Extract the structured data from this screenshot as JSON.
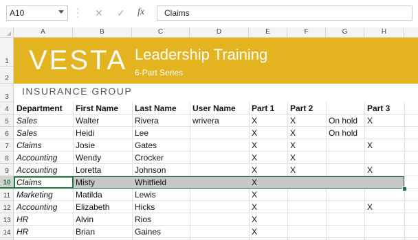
{
  "formula_bar": {
    "name_box": "A10",
    "cancel_icon": "close-icon",
    "enter_icon": "check-icon",
    "fx_label": "fx",
    "formula": "Claims"
  },
  "columns": [
    "A",
    "B",
    "C",
    "D",
    "E",
    "F",
    "G",
    "H"
  ],
  "rows": [
    "1",
    "2",
    "3",
    "4",
    "5",
    "6",
    "7",
    "8",
    "9",
    "10",
    "11",
    "12",
    "13",
    "14"
  ],
  "active_row": "10",
  "banner": {
    "logo": "VESTA",
    "logo_sub": "INSURANCE  GROUP",
    "title": "Leadership Training",
    "subtitle": "6-Part Series",
    "color": "#e3b320"
  },
  "table": {
    "headers": [
      "Department",
      "First Name",
      "Last Name",
      "User Name",
      "Part 1",
      "Part 2",
      "",
      "Part 3"
    ],
    "rows": [
      [
        "Sales",
        "Walter",
        "Rivera",
        "wrivera",
        "X",
        "X",
        "On hold",
        "X"
      ],
      [
        "Sales",
        "Heidi",
        "Lee",
        "",
        "X",
        "X",
        "On hold",
        ""
      ],
      [
        "Claims",
        "Josie",
        "Gates",
        "",
        "X",
        "X",
        "",
        "X"
      ],
      [
        "Accounting",
        "Wendy",
        "Crocker",
        "",
        "X",
        "X",
        "",
        ""
      ],
      [
        "Accounting",
        "Loretta",
        "Johnson",
        "",
        "X",
        "X",
        "",
        "X"
      ],
      [
        "Claims",
        "Misty",
        "Whitfield",
        "",
        "X",
        "",
        "",
        ""
      ],
      [
        "Marketing",
        "Matilda",
        "Lewis",
        "",
        "X",
        "",
        "",
        ""
      ],
      [
        "Accounting",
        "Elizabeth",
        "Hicks",
        "",
        "X",
        "",
        "",
        "X"
      ],
      [
        "HR",
        "Alvin",
        "Rios",
        "",
        "X",
        "",
        "",
        ""
      ],
      [
        "HR",
        "Brian",
        "Gaines",
        "",
        "X",
        "",
        "",
        ""
      ]
    ]
  },
  "accent_color": "#217346"
}
